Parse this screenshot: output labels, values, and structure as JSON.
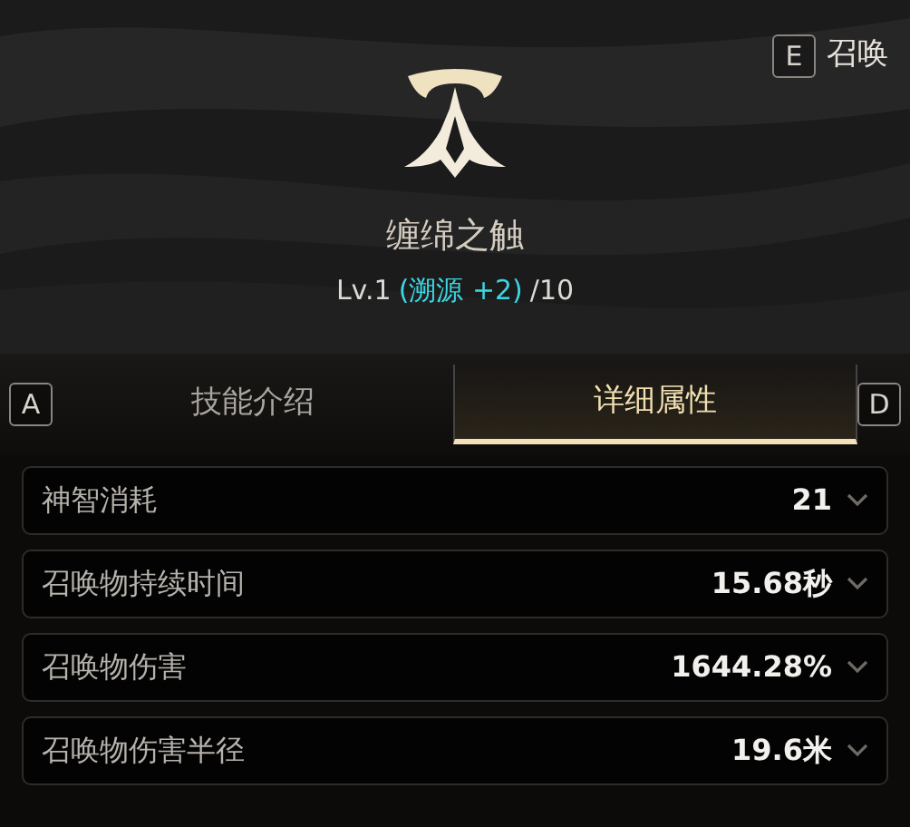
{
  "hotkey": {
    "key": "E",
    "label": "召唤"
  },
  "skill": {
    "name": "缠绵之触",
    "level": "Lv.1",
    "bonus": "(溯源 +2)",
    "max": "/10"
  },
  "tabs": [
    {
      "key": "A"
    },
    {
      "label": "技能介绍",
      "selected": false
    },
    {
      "label": "详细属性",
      "selected": true
    },
    {
      "key": "D"
    }
  ],
  "attributes": [
    {
      "name": "神智消耗",
      "value": "21",
      "expanded": false
    },
    {
      "name": "召唤物持续时间",
      "value": "15.68秒",
      "expanded": false
    },
    {
      "name": "召唤物伤害",
      "value": "1644.28%",
      "expanded": false
    },
    {
      "name": "召唤物伤害半径",
      "value": "19.6米",
      "expanded": false
    }
  ]
}
